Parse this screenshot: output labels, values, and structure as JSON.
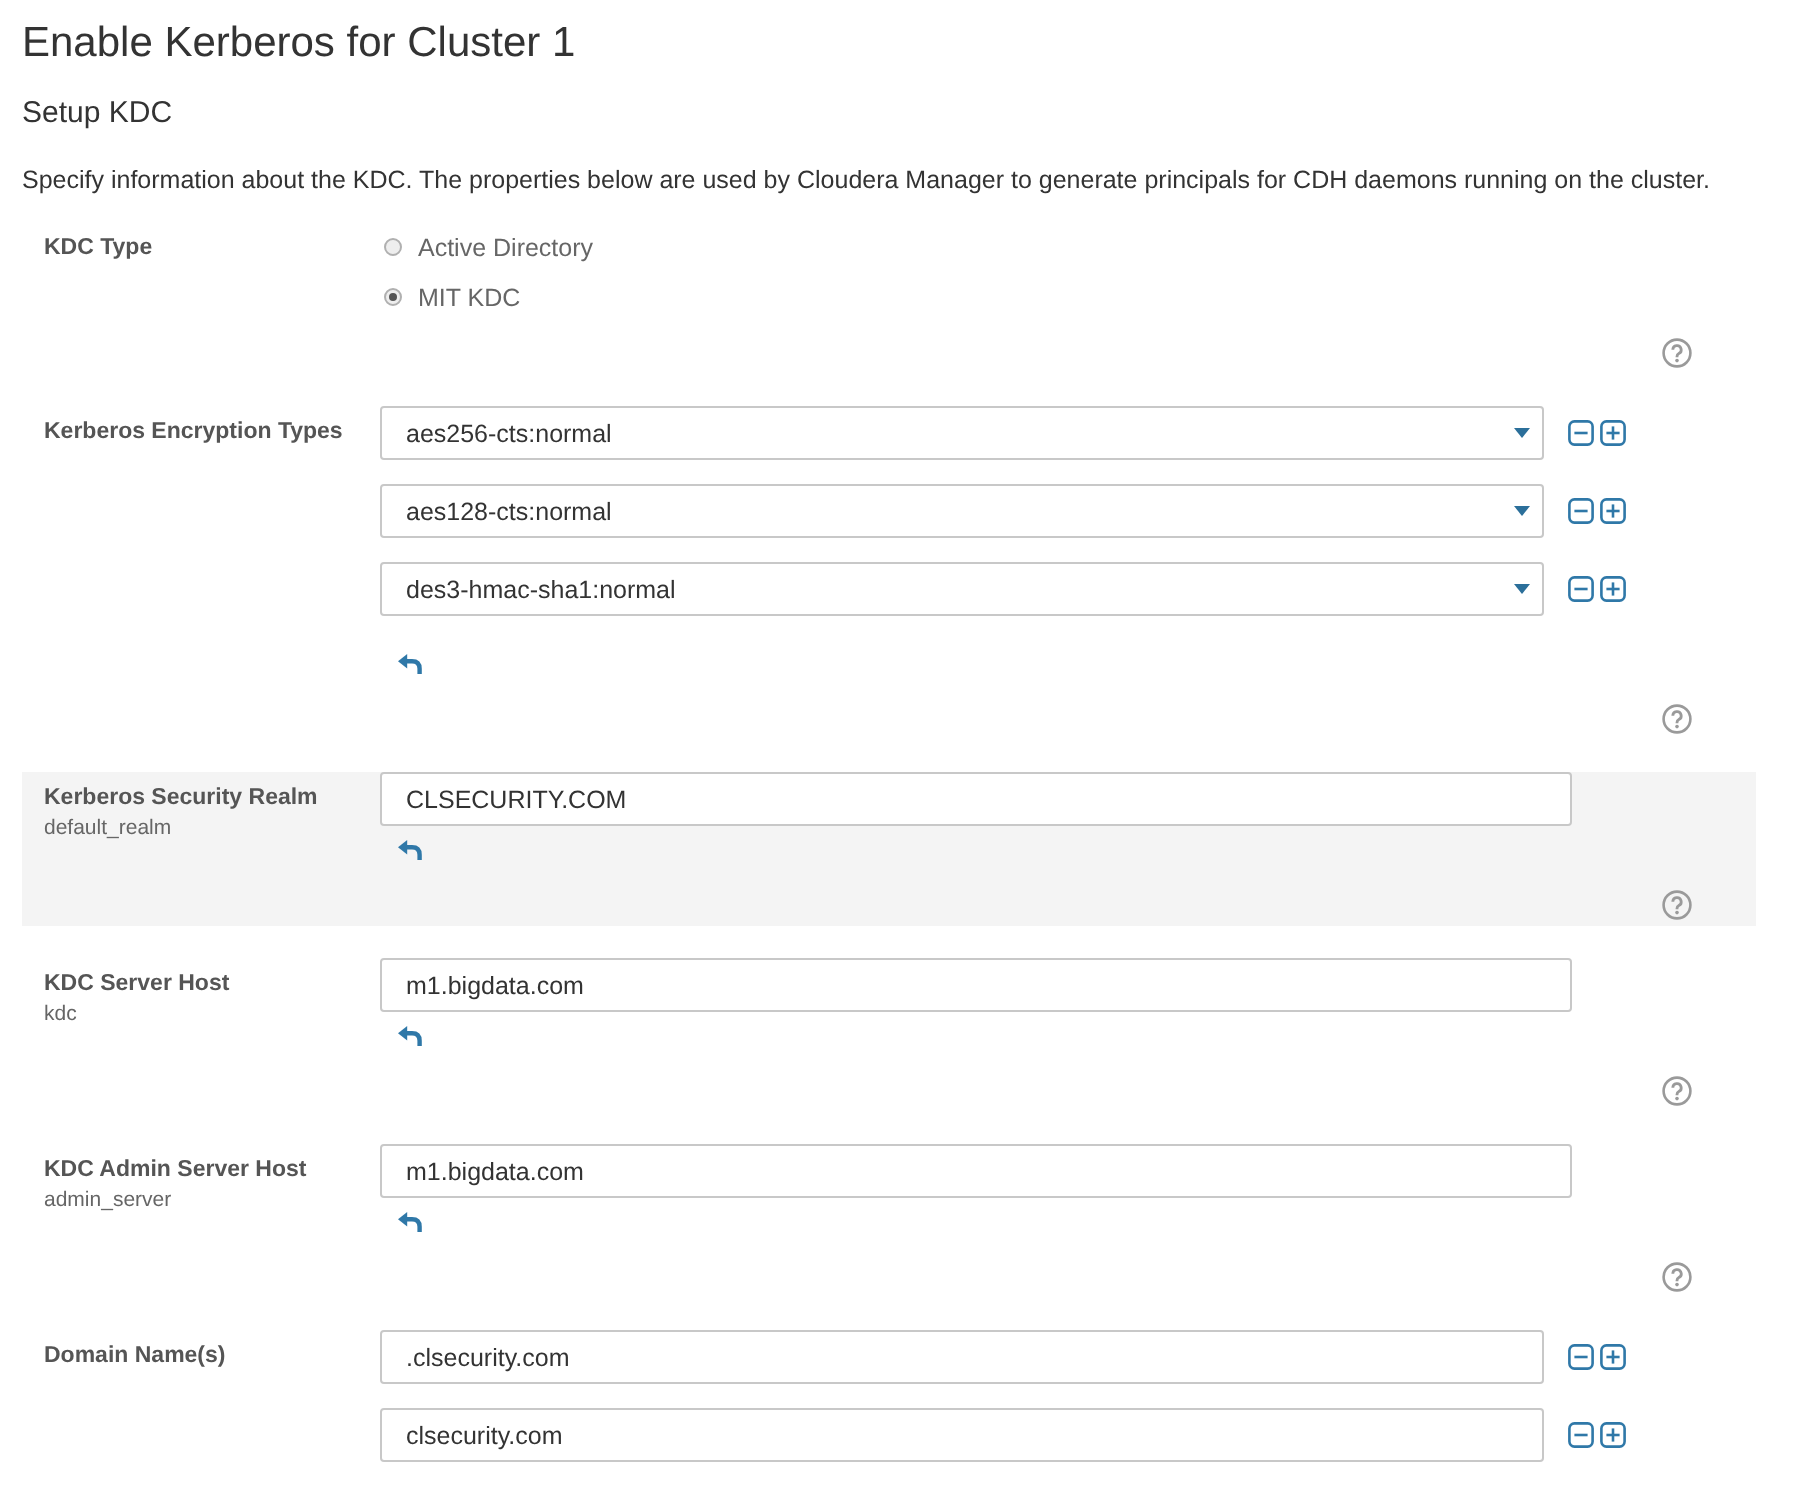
{
  "header": {
    "title": "Enable Kerberos for Cluster 1",
    "subtitle": "Setup KDC",
    "description": "Specify information about the KDC. The properties below are used by Cloudera Manager to generate principals for CDH daemons running on the cluster."
  },
  "properties": [
    {
      "kind": "radio",
      "label": "KDC Type",
      "highlighted": false,
      "revert": false,
      "help": true,
      "options": [
        {
          "label": "Active Directory",
          "selected": false
        },
        {
          "label": "MIT KDC",
          "selected": true
        }
      ]
    },
    {
      "kind": "select_list",
      "label": "Kerberos Encryption Types",
      "highlighted": false,
      "revert": true,
      "help": true,
      "values": [
        "aes256-cts:normal",
        "aes128-cts:normal",
        "des3-hmac-sha1:normal"
      ]
    },
    {
      "kind": "text",
      "label": "Kerberos Security Realm",
      "key": "default_realm",
      "highlighted": true,
      "revert": true,
      "help": true,
      "values": [
        "CLSECURITY.COM"
      ]
    },
    {
      "kind": "text",
      "label": "KDC Server Host",
      "key": "kdc",
      "highlighted": false,
      "revert": true,
      "help": true,
      "values": [
        "m1.bigdata.com"
      ]
    },
    {
      "kind": "text",
      "label": "KDC Admin Server Host",
      "key": "admin_server",
      "highlighted": false,
      "revert": true,
      "help": true,
      "values": [
        "m1.bigdata.com"
      ]
    },
    {
      "kind": "text_list",
      "label": "Domain Name(s)",
      "highlighted": false,
      "values": [
        ".clsecurity.com",
        "clsecurity.com"
      ]
    }
  ]
}
